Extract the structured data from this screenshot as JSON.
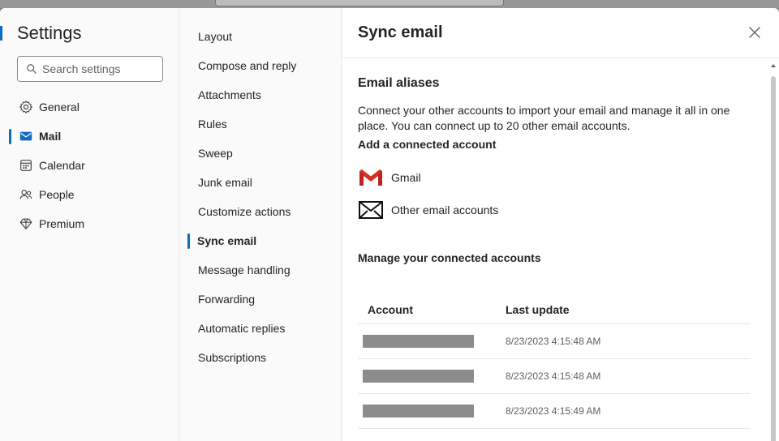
{
  "settings": {
    "title": "Settings",
    "search_placeholder": "Search settings"
  },
  "left_nav": [
    {
      "label": "General",
      "icon": "gear-icon"
    },
    {
      "label": "Mail",
      "icon": "mail-icon",
      "active": true
    },
    {
      "label": "Calendar",
      "icon": "calendar-icon"
    },
    {
      "label": "People",
      "icon": "people-icon"
    },
    {
      "label": "Premium",
      "icon": "diamond-icon"
    }
  ],
  "mid_nav": [
    {
      "label": "Layout"
    },
    {
      "label": "Compose and reply"
    },
    {
      "label": "Attachments"
    },
    {
      "label": "Rules"
    },
    {
      "label": "Sweep"
    },
    {
      "label": "Junk email"
    },
    {
      "label": "Customize actions"
    },
    {
      "label": "Sync email",
      "active": true
    },
    {
      "label": "Message handling"
    },
    {
      "label": "Forwarding"
    },
    {
      "label": "Automatic replies"
    },
    {
      "label": "Subscriptions"
    }
  ],
  "pane": {
    "title": "Sync email",
    "section_title": "Email aliases",
    "description": "Connect your other accounts to import your email and manage it all in one place. You can connect up to 20 other email accounts.",
    "add_heading": "Add a connected account",
    "gmail_label": "Gmail",
    "other_label": "Other email accounts",
    "manage_heading": "Manage your connected accounts",
    "table": {
      "col_account": "Account",
      "col_last_update": "Last update",
      "rows": [
        {
          "last_update": "8/23/2023 4:15:48 AM"
        },
        {
          "last_update": "8/23/2023 4:15:48 AM"
        },
        {
          "last_update": "8/23/2023 4:15:49 AM"
        }
      ]
    }
  },
  "colors": {
    "accent": "#0f6cbd",
    "gmail_red": "#d93025"
  }
}
